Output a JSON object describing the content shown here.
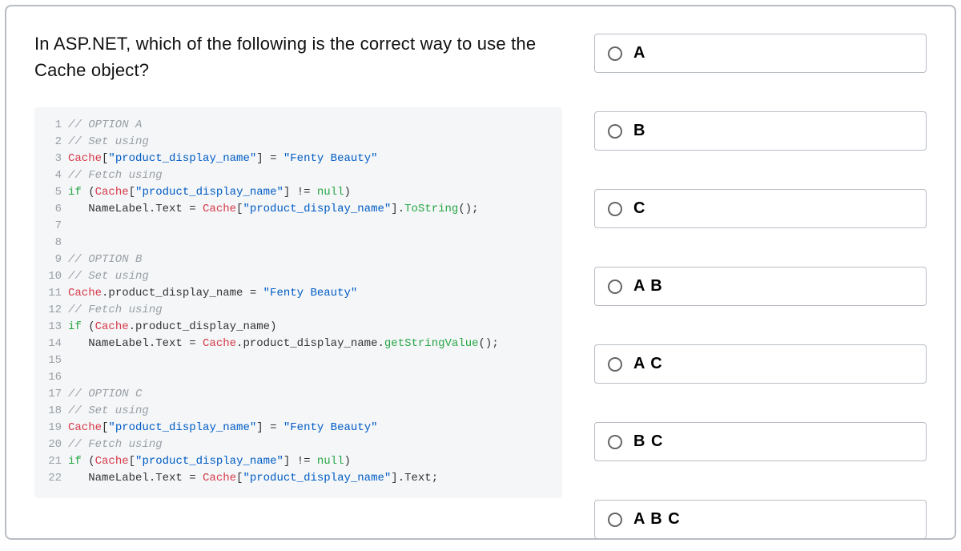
{
  "question": "In ASP.NET, which of the following is the correct way to use the Cache object?",
  "code_lines": [
    {
      "n": "1",
      "tokens": [
        {
          "cls": "tok-comment",
          "t": "// OPTION A"
        }
      ]
    },
    {
      "n": "2",
      "tokens": [
        {
          "cls": "tok-comment",
          "t": "// Set using"
        }
      ]
    },
    {
      "n": "3",
      "tokens": [
        {
          "cls": "tok-red",
          "t": "Cache"
        },
        {
          "cls": "tok-plain",
          "t": "["
        },
        {
          "cls": "tok-str",
          "t": "\"product_display_name\""
        },
        {
          "cls": "tok-plain",
          "t": "] = "
        },
        {
          "cls": "tok-str",
          "t": "\"Fenty Beauty\""
        }
      ]
    },
    {
      "n": "4",
      "tokens": [
        {
          "cls": "tok-comment",
          "t": "// Fetch using"
        }
      ]
    },
    {
      "n": "5",
      "tokens": [
        {
          "cls": "tok-key",
          "t": "if"
        },
        {
          "cls": "tok-plain",
          "t": " ("
        },
        {
          "cls": "tok-red",
          "t": "Cache"
        },
        {
          "cls": "tok-plain",
          "t": "["
        },
        {
          "cls": "tok-str",
          "t": "\"product_display_name\""
        },
        {
          "cls": "tok-plain",
          "t": "] != "
        },
        {
          "cls": "tok-key",
          "t": "null"
        },
        {
          "cls": "tok-plain",
          "t": ")"
        }
      ]
    },
    {
      "n": "6",
      "tokens": [
        {
          "cls": "tok-plain",
          "t": "   NameLabel.Text = "
        },
        {
          "cls": "tok-red",
          "t": "Cache"
        },
        {
          "cls": "tok-plain",
          "t": "["
        },
        {
          "cls": "tok-str",
          "t": "\"product_display_name\""
        },
        {
          "cls": "tok-plain",
          "t": "]."
        },
        {
          "cls": "tok-key",
          "t": "ToString"
        },
        {
          "cls": "tok-plain",
          "t": "();"
        }
      ]
    },
    {
      "n": "7",
      "tokens": [
        {
          "cls": "tok-plain",
          "t": ""
        }
      ]
    },
    {
      "n": "8",
      "tokens": [
        {
          "cls": "tok-plain",
          "t": ""
        }
      ]
    },
    {
      "n": "9",
      "tokens": [
        {
          "cls": "tok-comment",
          "t": "// OPTION B"
        }
      ]
    },
    {
      "n": "10",
      "tokens": [
        {
          "cls": "tok-comment",
          "t": "// Set using"
        }
      ]
    },
    {
      "n": "11",
      "tokens": [
        {
          "cls": "tok-red",
          "t": "Cache"
        },
        {
          "cls": "tok-plain",
          "t": ".product_display_name = "
        },
        {
          "cls": "tok-str",
          "t": "\"Fenty Beauty\""
        }
      ]
    },
    {
      "n": "12",
      "tokens": [
        {
          "cls": "tok-comment",
          "t": "// Fetch using"
        }
      ]
    },
    {
      "n": "13",
      "tokens": [
        {
          "cls": "tok-key",
          "t": "if"
        },
        {
          "cls": "tok-plain",
          "t": " ("
        },
        {
          "cls": "tok-red",
          "t": "Cache"
        },
        {
          "cls": "tok-plain",
          "t": ".product_display_name)"
        }
      ]
    },
    {
      "n": "14",
      "tokens": [
        {
          "cls": "tok-plain",
          "t": "   NameLabel.Text = "
        },
        {
          "cls": "tok-red",
          "t": "Cache"
        },
        {
          "cls": "tok-plain",
          "t": ".product_display_name."
        },
        {
          "cls": "tok-key",
          "t": "getStringValue"
        },
        {
          "cls": "tok-plain",
          "t": "();"
        }
      ]
    },
    {
      "n": "15",
      "tokens": [
        {
          "cls": "tok-plain",
          "t": ""
        }
      ]
    },
    {
      "n": "16",
      "tokens": [
        {
          "cls": "tok-plain",
          "t": ""
        }
      ]
    },
    {
      "n": "17",
      "tokens": [
        {
          "cls": "tok-comment",
          "t": "// OPTION C"
        }
      ]
    },
    {
      "n": "18",
      "tokens": [
        {
          "cls": "tok-comment",
          "t": "// Set using"
        }
      ]
    },
    {
      "n": "19",
      "tokens": [
        {
          "cls": "tok-red",
          "t": "Cache"
        },
        {
          "cls": "tok-plain",
          "t": "["
        },
        {
          "cls": "tok-str",
          "t": "\"product_display_name\""
        },
        {
          "cls": "tok-plain",
          "t": "] = "
        },
        {
          "cls": "tok-str",
          "t": "\"Fenty Beauty\""
        }
      ]
    },
    {
      "n": "20",
      "tokens": [
        {
          "cls": "tok-comment",
          "t": "// Fetch using"
        }
      ]
    },
    {
      "n": "21",
      "tokens": [
        {
          "cls": "tok-key",
          "t": "if"
        },
        {
          "cls": "tok-plain",
          "t": " ("
        },
        {
          "cls": "tok-red",
          "t": "Cache"
        },
        {
          "cls": "tok-plain",
          "t": "["
        },
        {
          "cls": "tok-str",
          "t": "\"product_display_name\""
        },
        {
          "cls": "tok-plain",
          "t": "] != "
        },
        {
          "cls": "tok-key",
          "t": "null"
        },
        {
          "cls": "tok-plain",
          "t": ")"
        }
      ]
    },
    {
      "n": "22",
      "tokens": [
        {
          "cls": "tok-plain",
          "t": "   NameLabel.Text = "
        },
        {
          "cls": "tok-red",
          "t": "Cache"
        },
        {
          "cls": "tok-plain",
          "t": "["
        },
        {
          "cls": "tok-str",
          "t": "\"product_display_name\""
        },
        {
          "cls": "tok-plain",
          "t": "].Text;"
        }
      ]
    }
  ],
  "answers": [
    {
      "label": "A"
    },
    {
      "label": "B"
    },
    {
      "label": "C"
    },
    {
      "label": "A B"
    },
    {
      "label": "A C"
    },
    {
      "label": "B C"
    },
    {
      "label": "A B C"
    }
  ]
}
